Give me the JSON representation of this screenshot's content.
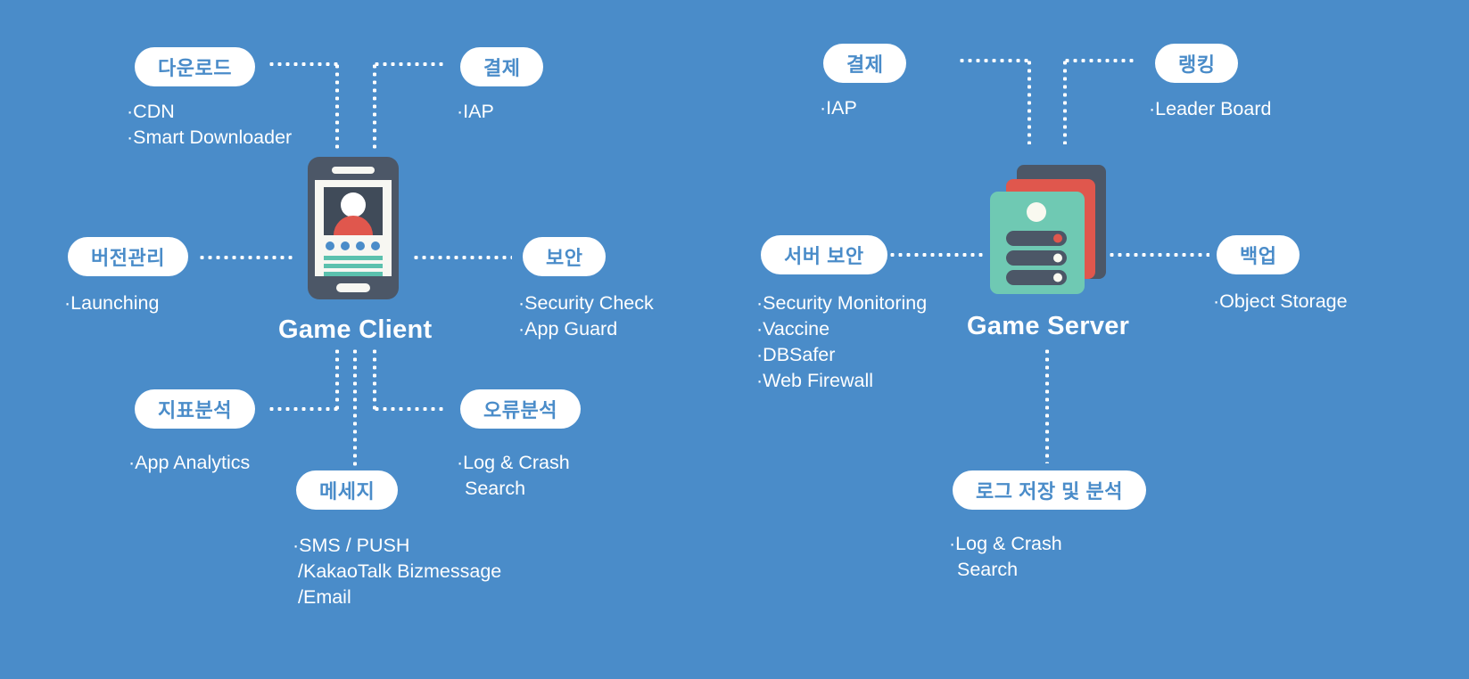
{
  "theme": {
    "background": "#4a8cc9",
    "chip_bg": "#ffffff",
    "chip_text": "#4a8cc9",
    "body_text": "#ffffff",
    "device_dark": "#4c5767",
    "device_screen": "#f7f7f2",
    "avatar_red": "#e0574d",
    "accent_teal": "#6fc9b3",
    "dot_blue": "#4a8cc9"
  },
  "nodes": {
    "client": {
      "title": "Game Client",
      "icon": "smartphone-icon"
    },
    "server": {
      "title": "Game Server",
      "icon": "server-stack-icon"
    }
  },
  "client_services": [
    {
      "id": "download",
      "chip": "다운로드",
      "items": [
        "CDN",
        "Smart Downloader"
      ]
    },
    {
      "id": "payment",
      "chip": "결제",
      "items": [
        "IAP"
      ]
    },
    {
      "id": "version-management",
      "chip": "버전관리",
      "items": [
        "Launching"
      ]
    },
    {
      "id": "security",
      "chip": "보안",
      "items": [
        "Security Check",
        "App Guard"
      ]
    },
    {
      "id": "metrics-analysis",
      "chip": "지표분석",
      "items": [
        "App Analytics"
      ]
    },
    {
      "id": "error-analysis",
      "chip": "오류분석",
      "items": [
        "Log & Crash",
        "Search"
      ]
    },
    {
      "id": "message",
      "chip": "메세지",
      "items": [
        "SMS / PUSH",
        "/KakaoTalk Bizmessage",
        "/Email"
      ]
    }
  ],
  "server_services": [
    {
      "id": "server-payment",
      "chip": "결제",
      "items": [
        "IAP"
      ]
    },
    {
      "id": "ranking",
      "chip": "랭킹",
      "items": [
        "Leader Board"
      ]
    },
    {
      "id": "server-security",
      "chip": "서버 보안",
      "items": [
        "Security Monitoring",
        "Vaccine",
        "DBSafer",
        "Web Firewall"
      ]
    },
    {
      "id": "backup",
      "chip": "백업",
      "items": [
        "Object Storage"
      ]
    },
    {
      "id": "log-storage-analysis",
      "chip": "로그 저장 및 분석",
      "items": [
        "Log & Crash",
        "Search"
      ]
    }
  ],
  "chart_data": {
    "type": "diagram",
    "title": "Game Client / Game Server service architecture",
    "nodes": [
      "Game Client",
      "Game Server"
    ],
    "edges": [
      {
        "from": "다운로드",
        "to": "Game Client"
      },
      {
        "from": "결제",
        "to": "Game Client"
      },
      {
        "from": "버전관리",
        "to": "Game Client"
      },
      {
        "from": "보안",
        "to": "Game Client"
      },
      {
        "from": "지표분석",
        "to": "Game Client"
      },
      {
        "from": "오류분석",
        "to": "Game Client"
      },
      {
        "from": "메세지",
        "to": "Game Client"
      },
      {
        "from": "결제",
        "to": "Game Server"
      },
      {
        "from": "랭킹",
        "to": "Game Server"
      },
      {
        "from": "서버 보안",
        "to": "Game Server"
      },
      {
        "from": "백업",
        "to": "Game Server"
      },
      {
        "from": "로그 저장 및 분석",
        "to": "Game Server"
      }
    ]
  }
}
